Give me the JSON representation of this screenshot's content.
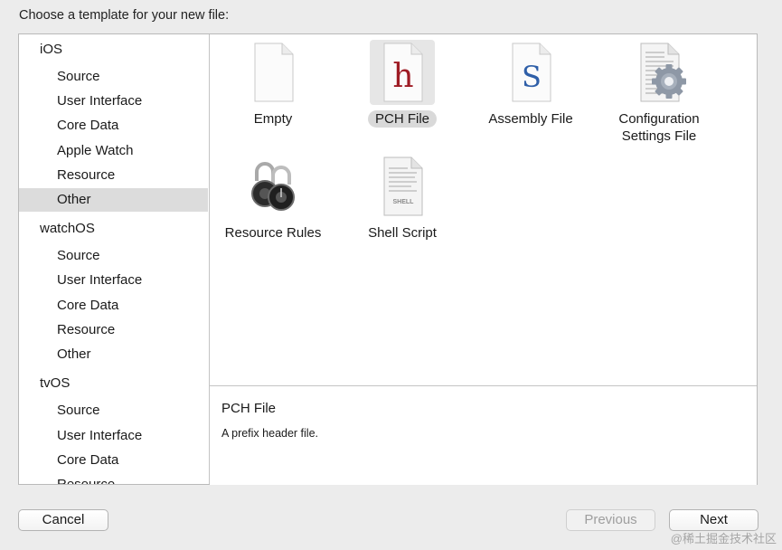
{
  "dialog": {
    "prompt": "Choose a template for your new file:"
  },
  "sidebar": {
    "groups": [
      {
        "name": "iOS",
        "items": [
          "Source",
          "User Interface",
          "Core Data",
          "Apple Watch",
          "Resource",
          "Other"
        ]
      },
      {
        "name": "watchOS",
        "items": [
          "Source",
          "User Interface",
          "Core Data",
          "Resource",
          "Other"
        ]
      },
      {
        "name": "tvOS",
        "items": [
          "Source",
          "User Interface",
          "Core Data",
          "Resource"
        ]
      }
    ],
    "selected": "iOS / Other"
  },
  "templates": {
    "items": [
      {
        "label": "Empty",
        "icon": "blank-file-icon"
      },
      {
        "label": "PCH File",
        "icon": "h-file-icon",
        "selected": true
      },
      {
        "label": "Assembly File",
        "icon": "s-file-icon"
      },
      {
        "label": "Configuration Settings File",
        "line1": "Configuration",
        "line2": "Settings File",
        "icon": "gear-document-icon"
      },
      {
        "label": "Resource Rules",
        "icon": "padlock-icon"
      },
      {
        "label": "Shell Script",
        "icon": "shell-file-icon",
        "badge": "SHELL"
      }
    ],
    "h_glyph": "h",
    "s_glyph": "S"
  },
  "description": {
    "title": "PCH File",
    "text": "A prefix header file."
  },
  "buttons": {
    "cancel": "Cancel",
    "previous": "Previous",
    "next": "Next"
  },
  "watermark": "@稀土掘金技术社区",
  "colors": {
    "h_glyph": "#9e1b24",
    "s_glyph": "#2f5fa8",
    "selection": "#dcdcdc"
  }
}
